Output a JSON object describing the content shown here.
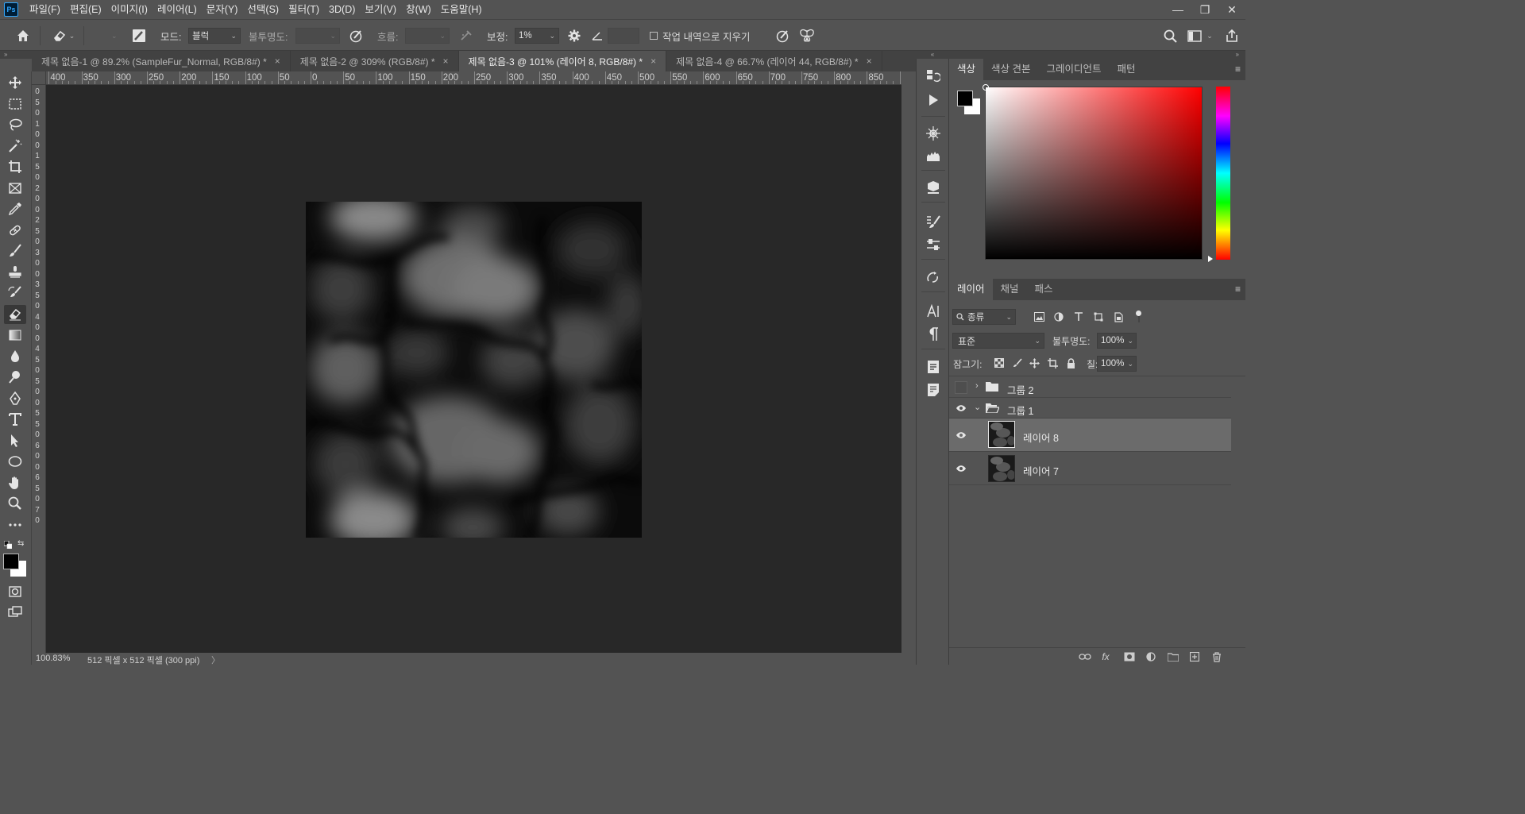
{
  "app": {
    "logo": "Ps"
  },
  "menu": [
    "파일(F)",
    "편집(E)",
    "이미지(I)",
    "레이어(L)",
    "문자(Y)",
    "선택(S)",
    "필터(T)",
    "3D(D)",
    "보기(V)",
    "창(W)",
    "도움말(H)"
  ],
  "window_controls": {
    "minimize": "—",
    "restore": "❐",
    "close": "✕"
  },
  "options": {
    "mode_label": "모드:",
    "mode_value": "블럭",
    "opacity_label": "불투명도:",
    "flow_label": "흐름:",
    "smoothing_label": "보정:",
    "smoothing_value": "1%",
    "erase_history_label": "작업 내역으로 지우기"
  },
  "tabs": [
    {
      "label": "제목 없음-1 @ 89.2% (SampleFur_Normal, RGB/8#) *",
      "close": "×"
    },
    {
      "label": "제목 없음-2 @ 309% (RGB/8#) *",
      "close": "×"
    },
    {
      "label": "제목 없음-3 @ 101% (레이어 8, RGB/8#) *",
      "close": "×",
      "active": true
    },
    {
      "label": "제목 없음-4 @ 66.7% (레이어 44, RGB/8#) *",
      "close": "×"
    }
  ],
  "ruler_h": [
    "400",
    "350",
    "300",
    "250",
    "200",
    "150",
    "100",
    "50",
    "0",
    "50",
    "100",
    "150",
    "200",
    "250",
    "300",
    "350",
    "400",
    "450",
    "500",
    "550",
    "600",
    "650",
    "700",
    "750",
    "800",
    "850",
    "9"
  ],
  "ruler_v": [
    "0",
    "5",
    "0",
    "1",
    "0",
    "0",
    "1",
    "5",
    "0",
    "2",
    "0",
    "0",
    "2",
    "5",
    "0",
    "3",
    "0",
    "0",
    "3",
    "5",
    "0",
    "4",
    "0",
    "0",
    "4",
    "5",
    "0",
    "5",
    "0",
    "0",
    "5",
    "5",
    "0",
    "6",
    "0",
    "0",
    "6",
    "5",
    "0",
    "7",
    "0"
  ],
  "status": {
    "zoom": "100.83%",
    "doc_info": "512 픽셀 x 512 픽셀 (300 ppi)",
    "arrow": "〉"
  },
  "color_panel": {
    "tabs": [
      "색상",
      "색상 견본",
      "그레이디언트",
      "패턴"
    ],
    "hue_color": "#ff0000",
    "foreground": "#000000",
    "background": "#ffffff"
  },
  "layers_panel": {
    "tabs": [
      "레이어",
      "채널",
      "패스"
    ],
    "filter_label": "종류",
    "blend_mode": "표준",
    "opacity_label": "불투명도:",
    "opacity_value": "100%",
    "lock_label": "잠그기:",
    "fill_label": "칠:",
    "fill_value": "100%",
    "layers": [
      {
        "name": "그룹 2",
        "type": "group",
        "visible": false,
        "expanded": false
      },
      {
        "name": "그룹 1",
        "type": "group",
        "visible": true,
        "expanded": true
      },
      {
        "name": "레이어 8",
        "type": "layer",
        "visible": true,
        "selected": true
      },
      {
        "name": "레이어 7",
        "type": "layer",
        "visible": true,
        "selected": false
      }
    ],
    "footer_fx": "fx"
  }
}
